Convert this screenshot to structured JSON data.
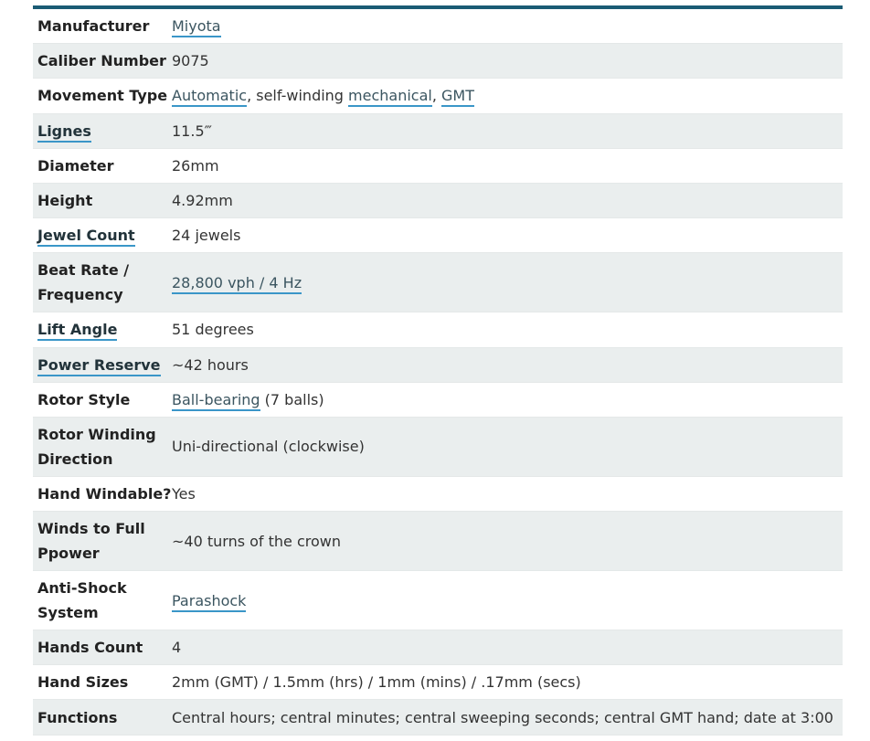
{
  "specs": {
    "manufacturer": {
      "label": "Manufacturer",
      "value": "Miyota"
    },
    "caliber": {
      "label": "Caliber Number",
      "value": "9075"
    },
    "movement": {
      "label": "Movement Type",
      "automatic": "Automatic",
      "sep1": ", self-winding ",
      "mechanical": "mechanical",
      "sep2": ", ",
      "gmt": "GMT"
    },
    "lignes": {
      "label": "Lignes",
      "value": "11.5‴"
    },
    "diameter": {
      "label": "Diameter",
      "value": "26mm"
    },
    "height": {
      "label": "Height",
      "value": "4.92mm"
    },
    "jewels": {
      "label": "Jewel Count",
      "value": "24 jewels"
    },
    "beat_rate": {
      "label_line1": "Beat Rate /",
      "label_line2": "Frequency",
      "value": "28,800 vph / 4 Hz"
    },
    "lift_angle": {
      "label": "Lift Angle",
      "value": "51 degrees"
    },
    "power_reserve": {
      "label": "Power Reserve",
      "value": "~42 hours"
    },
    "rotor_style": {
      "label": "Rotor Style",
      "link": "Ball-bearing",
      "rest": " (7 balls)"
    },
    "rotor_direction": {
      "label_line1": "Rotor Winding",
      "label_line2": "Direction",
      "value": "Uni-directional (clockwise)"
    },
    "hand_windable": {
      "label": "Hand Windable?",
      "value": "Yes"
    },
    "winds": {
      "label_line1": "Winds to Full",
      "label_line2": "Ppower",
      "value": "~40 turns of the crown"
    },
    "anti_shock": {
      "label_line1": "Anti-Shock",
      "label_line2": "System",
      "value": "Parashock"
    },
    "hands_count": {
      "label": "Hands Count",
      "value": "4"
    },
    "hand_sizes": {
      "label": "Hand Sizes",
      "value": "2mm (GMT) / 1.5mm (hrs) / 1mm (mins) / .17mm (secs)"
    },
    "functions": {
      "label": "Functions",
      "value": "Central hours; central minutes; central sweeping seconds; central GMT hand; date at 3:00"
    }
  },
  "colors": {
    "header_rule": "#1b5c74",
    "link_underline": "#3a96c8",
    "alt_row": "#eaeeee"
  }
}
